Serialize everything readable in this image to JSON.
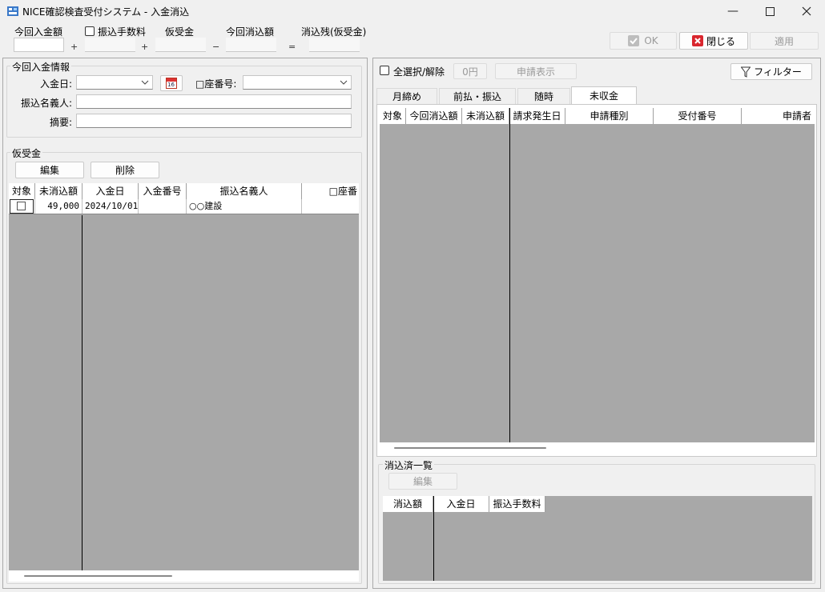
{
  "window": {
    "title": "NICE確認検査受付システム - 入金消込"
  },
  "summary": {
    "labels": {
      "current_payment": "今回入金額",
      "transfer_fee": "振込手数料",
      "provisional": "仮受金",
      "current_clear": "今回消込額",
      "remaining": "消込残(仮受金)"
    },
    "ops": [
      "+",
      "+",
      "−",
      "="
    ]
  },
  "toolbar": {
    "ok_label": "OK",
    "close_label": "閉じる",
    "apply_label": "適用"
  },
  "payment_info": {
    "title": "今回入金情報",
    "date_label": "入金日:",
    "calendar_day": "16",
    "account_label": "□座番号:",
    "payer_label": "振込名義人:",
    "memo_label": "摘要:"
  },
  "provisional_panel": {
    "title": "仮受金",
    "edit_label": "編集",
    "delete_label": "削除",
    "columns": [
      "対象",
      "未消込額",
      "入金日",
      "入金番号",
      "振込名義人",
      "□座番"
    ],
    "rows": [
      {
        "amount": "49,000",
        "date": "2024/10/01",
        "number": "",
        "payer": "○○建設",
        "account": ""
      }
    ]
  },
  "right_panel": {
    "select_all_label": "全選択/解除",
    "amount_badge": "0円",
    "show_request_label": "申請表示",
    "filter_label": "フィルター",
    "tabs": [
      "月締め",
      "前払・振込",
      "随時",
      "未収金"
    ],
    "active_tab": 3,
    "columns": [
      "対象",
      "今回消込額",
      "未消込額",
      "請求発生日",
      "申請種別",
      "受付番号",
      "申請者"
    ]
  },
  "cleared_panel": {
    "title": "消込済一覧",
    "edit_label": "編集",
    "columns": [
      "消込額",
      "入金日",
      "振込手数料"
    ]
  }
}
